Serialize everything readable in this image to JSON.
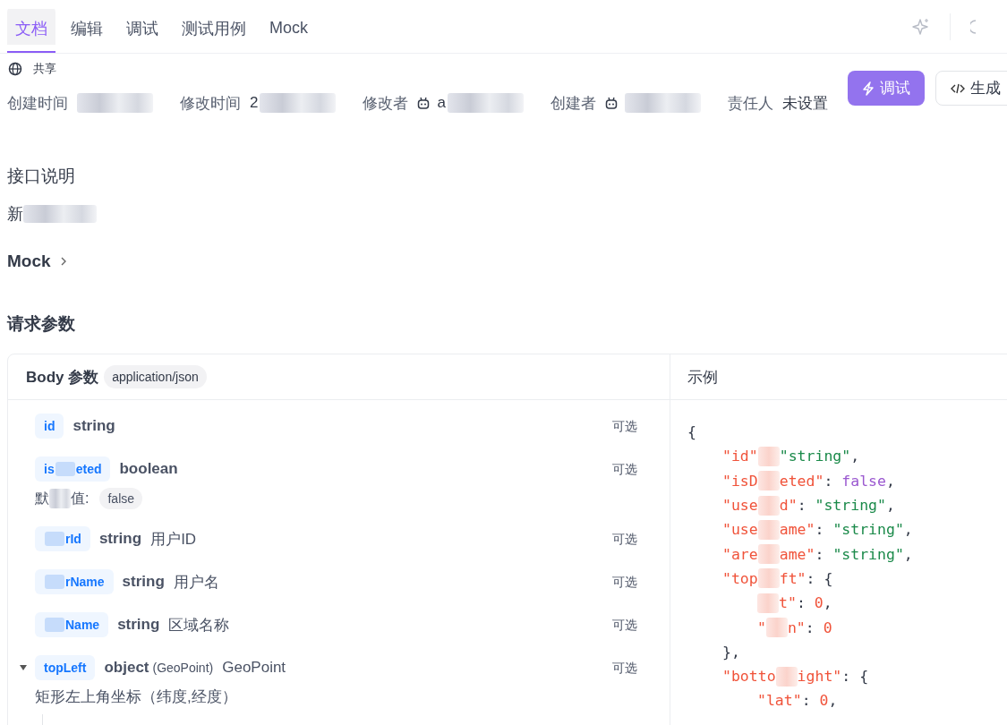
{
  "tabs": [
    {
      "label": "文档",
      "selected": true
    },
    {
      "label": "编辑",
      "selected": false
    },
    {
      "label": "调试",
      "selected": false
    },
    {
      "label": "测试用例",
      "selected": false
    },
    {
      "label": "Mock",
      "selected": false
    }
  ],
  "share": {
    "label": "共享"
  },
  "meta": [
    {
      "label": "创建时间",
      "kind": "time"
    },
    {
      "label": "修改时间",
      "kind": "time",
      "value": "2"
    },
    {
      "label": "修改者",
      "kind": "user",
      "value": "a"
    },
    {
      "label": "创建者",
      "kind": "user"
    },
    {
      "label": "责任人",
      "kind": "text",
      "value": "未设置"
    }
  ],
  "actions": [
    {
      "label": "调试",
      "kind": "primary"
    },
    {
      "label": "生成",
      "kind": "code"
    }
  ],
  "description": {
    "title": "接口说明",
    "text": "新"
  },
  "mock": {
    "label": "Mock"
  },
  "request": {
    "title": "请求参数",
    "body_label": "Body 参数",
    "content_type": "application/json",
    "example_label": "示例",
    "params": [
      {
        "name": [
          {
            "kind": "text",
            "text": "id"
          }
        ],
        "type": "string",
        "optional": "可选"
      },
      {
        "name": [
          {
            "kind": "text",
            "text": "is"
          },
          {
            "kind": "blur"
          },
          {
            "kind": "text",
            "text": "eted"
          }
        ],
        "type": "boolean",
        "optional": "可选",
        "default_label": [
          {
            "kind": "text",
            "text": "默"
          },
          {
            "kind": "blur"
          },
          {
            "kind": "text",
            "text": "值:"
          }
        ],
        "default": "false"
      },
      {
        "name": [
          {
            "kind": "blur"
          },
          {
            "kind": "text",
            "text": "rId"
          }
        ],
        "type": "string",
        "desc": "用户ID",
        "optional": "可选"
      },
      {
        "name": [
          {
            "kind": "blur"
          },
          {
            "kind": "text",
            "text": "rName"
          }
        ],
        "type": "string",
        "desc": "用户名",
        "optional": "可选"
      },
      {
        "name": [
          {
            "kind": "blur"
          },
          {
            "kind": "text",
            "text": "Name"
          }
        ],
        "type": "string",
        "desc": "区域名称",
        "optional": "可选"
      },
      {
        "name": [
          {
            "kind": "text",
            "text": "topLeft"
          }
        ],
        "type": "object",
        "type_ref": "(GeoPoint)",
        "desc": "GeoPoint",
        "optional": "可选",
        "expanded": true,
        "note": "矩形左上角坐标（纬度,经度）"
      }
    ],
    "example": [
      {
        "parts": [
          {
            "kind": "punct",
            "text": "{"
          }
        ],
        "children": [
          {
            "parts": [
              {
                "kind": "key",
                "text": "\"id\""
              },
              {
                "kind": "blur"
              },
              {
                "kind": "string",
                "text": "\"string\""
              },
              {
                "kind": "punct",
                "text": ","
              }
            ]
          },
          {
            "parts": [
              {
                "kind": "key",
                "text": "\"isD"
              },
              {
                "kind": "blur"
              },
              {
                "kind": "key",
                "text": "eted\""
              },
              {
                "kind": "punct",
                "text": ": "
              },
              {
                "kind": "bool",
                "text": "false"
              },
              {
                "kind": "punct",
                "text": ","
              }
            ]
          },
          {
            "parts": [
              {
                "kind": "key",
                "text": "\"use"
              },
              {
                "kind": "blur"
              },
              {
                "kind": "key",
                "text": "d\""
              },
              {
                "kind": "punct",
                "text": ": "
              },
              {
                "kind": "string",
                "text": "\"string\""
              },
              {
                "kind": "punct",
                "text": ","
              }
            ]
          },
          {
            "parts": [
              {
                "kind": "key",
                "text": "\"use"
              },
              {
                "kind": "blur"
              },
              {
                "kind": "key",
                "text": "ame\""
              },
              {
                "kind": "punct",
                "text": ": "
              },
              {
                "kind": "string",
                "text": "\"string\""
              },
              {
                "kind": "punct",
                "text": ","
              }
            ]
          },
          {
            "parts": [
              {
                "kind": "key",
                "text": "\"are"
              },
              {
                "kind": "blur"
              },
              {
                "kind": "key",
                "text": "ame\""
              },
              {
                "kind": "punct",
                "text": ": "
              },
              {
                "kind": "string",
                "text": "\"string\""
              },
              {
                "kind": "punct",
                "text": ","
              }
            ]
          },
          {
            "parts": [
              {
                "kind": "key",
                "text": "\"top"
              },
              {
                "kind": "blur"
              },
              {
                "kind": "key",
                "text": "ft\""
              },
              {
                "kind": "punct",
                "text": ": {"
              }
            ],
            "children": [
              {
                "parts": [
                  {
                    "kind": "blur"
                  },
                  {
                    "kind": "key",
                    "text": "t\""
                  },
                  {
                    "kind": "punct",
                    "text": ": "
                  },
                  {
                    "kind": "number",
                    "text": "0"
                  },
                  {
                    "kind": "punct",
                    "text": ","
                  }
                ]
              },
              {
                "parts": [
                  {
                    "kind": "key",
                    "text": "\""
                  },
                  {
                    "kind": "blur"
                  },
                  {
                    "kind": "key",
                    "text": "n\""
                  },
                  {
                    "kind": "punct",
                    "text": ": "
                  },
                  {
                    "kind": "number",
                    "text": "0"
                  }
                ]
              }
            ]
          },
          {
            "parts": [
              {
                "kind": "punct",
                "text": "},"
              }
            ]
          },
          {
            "parts": [
              {
                "kind": "key",
                "text": "\"botto"
              },
              {
                "kind": "blur"
              },
              {
                "kind": "key",
                "text": "ight\""
              },
              {
                "kind": "punct",
                "text": ": {"
              }
            ],
            "children": [
              {
                "parts": [
                  {
                    "kind": "key",
                    "text": "\"lat\""
                  },
                  {
                    "kind": "punct",
                    "text": ": "
                  },
                  {
                    "kind": "number",
                    "text": "0"
                  },
                  {
                    "kind": "punct",
                    "text": ","
                  }
                ]
              }
            ]
          }
        ]
      }
    ]
  }
}
